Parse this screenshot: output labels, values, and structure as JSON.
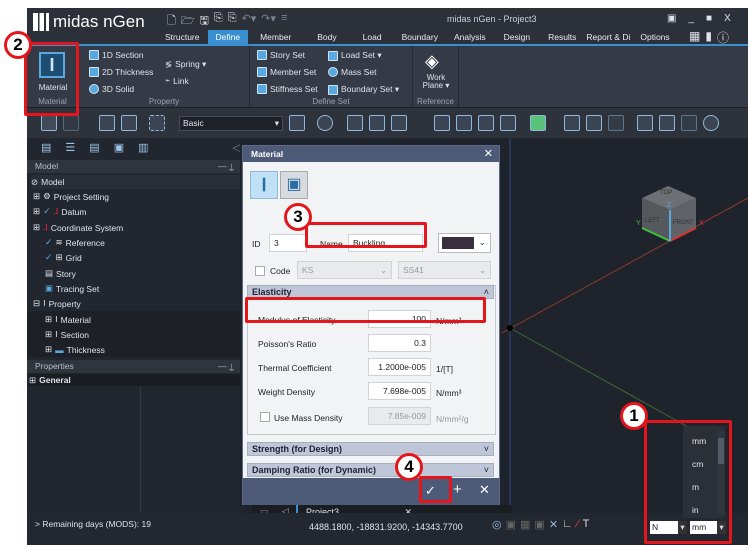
{
  "app": {
    "logo": "midas nGen",
    "window_title": "midas nGen - Project3",
    "window_controls": [
      "▣",
      "_",
      "■",
      "X"
    ]
  },
  "tabs": [
    "Structure",
    "Define",
    "Member",
    "Body",
    "Load",
    "Boundary",
    "Analysis",
    "Design",
    "Results",
    "Report & Di",
    "Options"
  ],
  "ribbon": {
    "material": {
      "button": "Material",
      "group": "Material"
    },
    "property": {
      "items": [
        "1D Section",
        "2D Thickness",
        "3D Solid",
        "Spring ▾",
        "Link"
      ],
      "group": "Property"
    },
    "define_set": {
      "items": [
        "Story Set",
        "Member Set",
        "Stiffness Set",
        "Load Set ▾",
        "Mass Set",
        "Boundary Set ▾"
      ],
      "group": "Define Set"
    },
    "reference": {
      "button_line1": "Work",
      "button_line2": "Plane ▾",
      "group": "Reference"
    }
  },
  "toolbar": {
    "mode_select": "Basic"
  },
  "left_panel": {
    "model_header": "Model",
    "tree": [
      {
        "label": "Model"
      },
      {
        "label": "Project Setting"
      },
      {
        "label": "Datum"
      },
      {
        "label": "Coordinate System"
      },
      {
        "label": "Reference"
      },
      {
        "label": "Grid"
      },
      {
        "label": "Story"
      },
      {
        "label": "Tracing Set"
      },
      {
        "label": "Property"
      },
      {
        "label": "Material"
      },
      {
        "label": "Section"
      },
      {
        "label": "Thickness"
      }
    ],
    "properties_header": "Properties",
    "general": "General"
  },
  "dialog": {
    "title": "Material",
    "id_label": "ID",
    "id_value": "3",
    "name_label": "Name",
    "name_value": "Buckling",
    "color": "#3a2f3c",
    "code_label": "Code",
    "code_value": "KS",
    "grade_value": "SS41",
    "elasticity": {
      "title": "Elasticity",
      "rows": [
        {
          "label": "Modulus of Elasticity",
          "value": "100",
          "unit": "N/mm²"
        },
        {
          "label": "Poisson's Ratio",
          "value": "0.3",
          "unit": ""
        },
        {
          "label": "Thermal Coefficient",
          "value": "1.2000e-005",
          "unit": "1/[T]"
        },
        {
          "label": "Weight Density",
          "value": "7.698e-005",
          "unit": "N/mm³"
        }
      ],
      "mass_label": "Use Mass Density",
      "mass_value": "7.85e-009",
      "mass_unit": "N/mm²/g"
    },
    "strength": "Strength (for Design)",
    "damping": "Damping Ratio (for Dynamic)"
  },
  "doc_tab": "Project3",
  "status": {
    "message": "> Remaining days (MODS): 19",
    "coords": "4488.1800, -18831.9200, -14343.7700",
    "force_unit": "N",
    "length_unit": "mm"
  },
  "unit_options": [
    "mm",
    "cm",
    "m",
    "in"
  ],
  "view_cube": {
    "top": "TOP",
    "left": "LEFT",
    "front": "FRONT",
    "x": "X",
    "y": "Y",
    "z": "Z"
  },
  "callouts": [
    "1",
    "2",
    "3",
    "4"
  ]
}
